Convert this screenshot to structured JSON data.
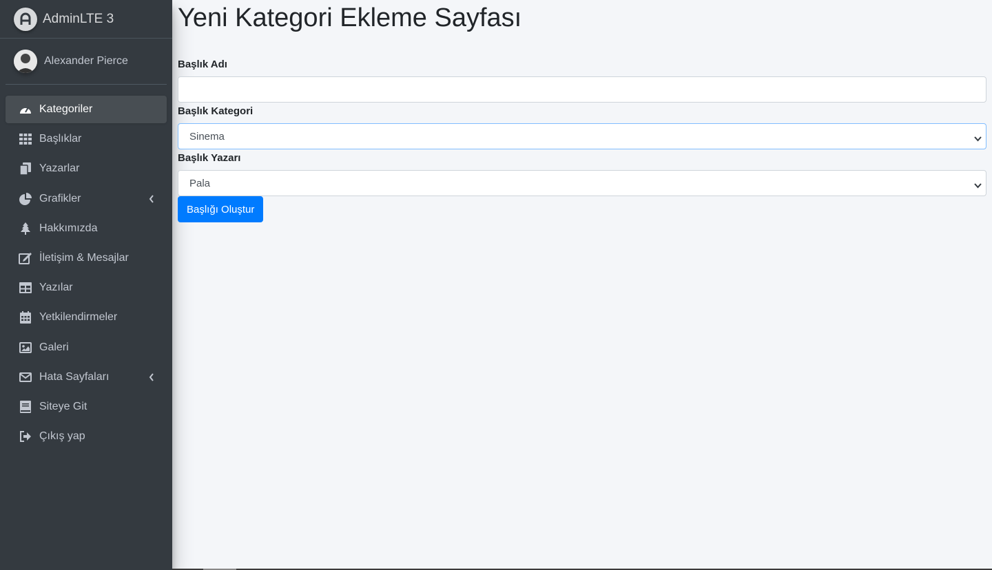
{
  "brand": {
    "name": "AdminLTE 3",
    "icon": "adminlte-logo-icon"
  },
  "user": {
    "name": "Alexander Pierce",
    "icon": "user-avatar"
  },
  "sidebar": {
    "items": [
      {
        "label": "Kategoriler",
        "icon": "tachometer-icon",
        "active": true
      },
      {
        "label": "Başlıklar",
        "icon": "grid-icon"
      },
      {
        "label": "Yazarlar",
        "icon": "copy-icon"
      },
      {
        "label": "Grafikler",
        "icon": "pie-chart-icon",
        "expandable": true
      },
      {
        "label": "Hakkımızda",
        "icon": "tree-icon"
      },
      {
        "label": "İletişim & Mesajlar",
        "icon": "edit-icon"
      },
      {
        "label": "Yazılar",
        "icon": "table-icon"
      },
      {
        "label": "Yetkilendirmeler",
        "icon": "calendar-icon"
      },
      {
        "label": "Galeri",
        "icon": "image-icon"
      },
      {
        "label": "Hata Sayfaları",
        "icon": "envelope-icon",
        "expandable": true
      },
      {
        "label": "Siteye Git",
        "icon": "book-icon"
      },
      {
        "label": "Çıkış yap",
        "icon": "sign-out-icon"
      }
    ]
  },
  "main": {
    "title": "Yeni Kategori Ekleme Sayfası",
    "form": {
      "title_label": "Başlık Adı",
      "title_value": "",
      "category_label": "Başlık Kategori",
      "category_value": "Sinema",
      "author_label": "Başlık Yazarı",
      "author_value": "Pala",
      "submit_label": "Başlığı Oluştur"
    }
  },
  "colors": {
    "sidebar_bg": "#343a40",
    "primary": "#007bff",
    "page_bg": "#f4f6f9"
  }
}
